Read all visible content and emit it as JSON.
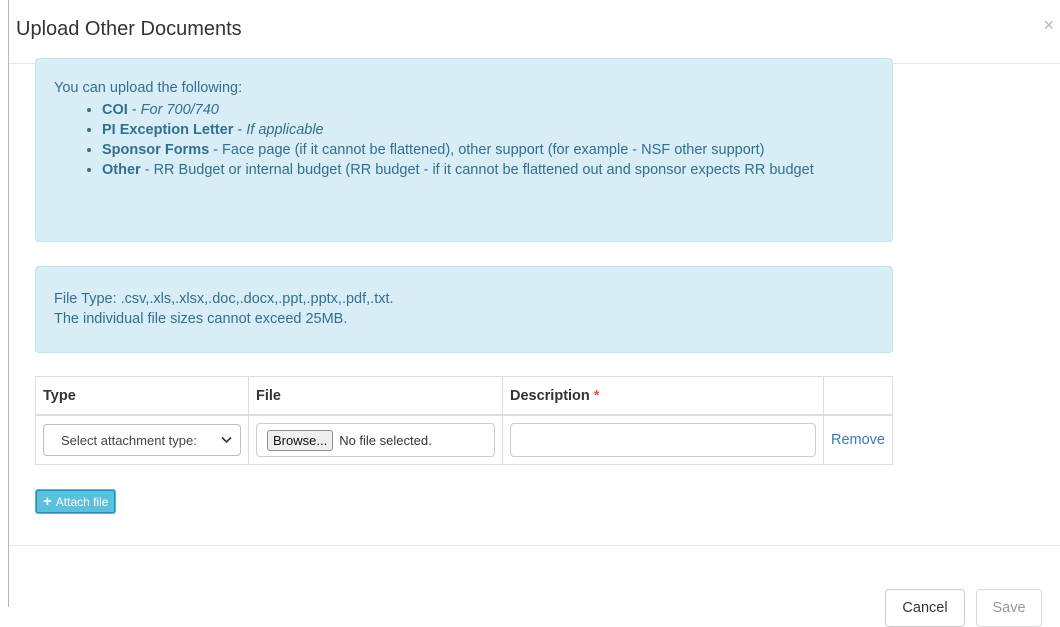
{
  "modal": {
    "title": "Upload Other Documents",
    "close_symbol": "×"
  },
  "info": {
    "intro": "You can upload the following:",
    "items": [
      {
        "bold": "COI",
        "sep": " - ",
        "italic": "For 700/740",
        "text": ""
      },
      {
        "bold": "PI Exception Letter",
        "sep": " - ",
        "italic": "If applicable",
        "text": ""
      },
      {
        "bold": "Sponsor Forms",
        "sep": " - ",
        "italic": "",
        "text": "Face page (if it cannot be flattened), other support (for example - NSF other support)"
      },
      {
        "bold": "Other",
        "sep": " - ",
        "italic": "",
        "text": "RR Budget or internal budget (RR budget - if it cannot be flattened out and sponsor expects RR budget"
      }
    ]
  },
  "filetype": {
    "line1": "File Type: .csv,.xls,.xlsx,.doc,.docx,.ppt,.pptx,.pdf,.txt.",
    "line2": "The individual file sizes cannot exceed 25MB."
  },
  "table": {
    "headers": {
      "type": "Type",
      "file": "File",
      "description": "Description",
      "required_mark": "*"
    },
    "row": {
      "type_select_value": "Select attachment type:",
      "browse_label": "Browse...",
      "file_status": "No file selected.",
      "description_value": "",
      "remove_label": "Remove"
    }
  },
  "attach_button": {
    "icon": "plus-icon",
    "label": "Attach file"
  },
  "footer": {
    "cancel_label": "Cancel",
    "save_label": "Save"
  }
}
